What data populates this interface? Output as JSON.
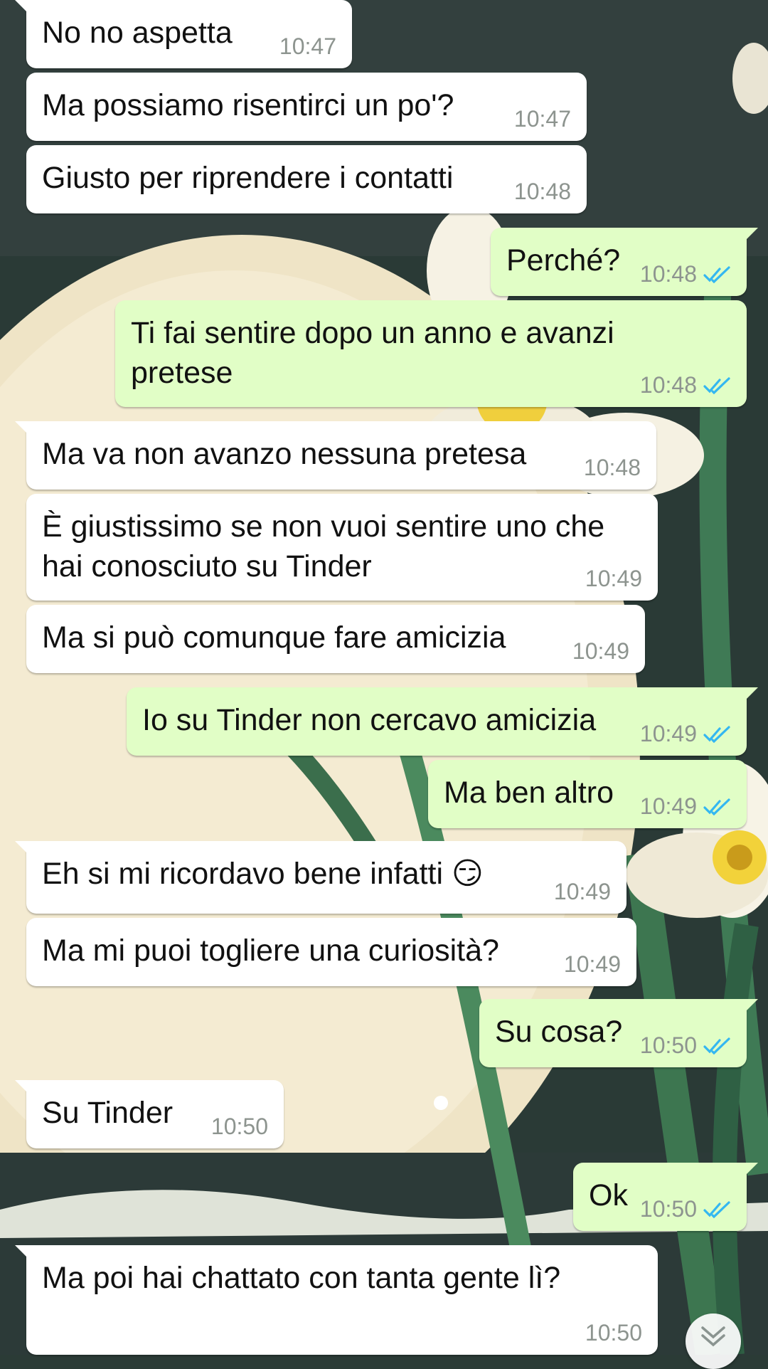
{
  "colors": {
    "incoming_bubble": "#ffffff",
    "outgoing_bubble": "#e1fec6",
    "timestamp": "#8d948f",
    "read_ticks": "#34b7f1"
  },
  "scroll_down_icon": "chevron-double-down-icon",
  "messages": [
    {
      "dir": "in",
      "text": "No no aspetta",
      "time": "10:47"
    },
    {
      "dir": "in",
      "text": "Ma possiamo risentirci un po'?",
      "time": "10:47"
    },
    {
      "dir": "in",
      "text": "Giusto per riprendere i contatti",
      "time": "10:48"
    },
    {
      "dir": "out",
      "text": "Perché?",
      "time": "10:48"
    },
    {
      "dir": "out",
      "text": "Ti fai sentire dopo un anno e avanzi\npretese",
      "time": "10:48"
    },
    {
      "dir": "in",
      "text": "Ma va non avanzo nessuna pretesa",
      "time": "10:48"
    },
    {
      "dir": "in",
      "text": "È giustissimo se non vuoi sentire uno che\nhai conosciuto su Tinder",
      "time": "10:49"
    },
    {
      "dir": "in",
      "text": "Ma si può comunque fare amicizia",
      "time": "10:49"
    },
    {
      "dir": "out",
      "text": "Io su Tinder non cercavo amicizia",
      "time": "10:49"
    },
    {
      "dir": "out",
      "text": "Ma ben altro",
      "time": "10:49"
    },
    {
      "dir": "in",
      "text": "Eh si mi ricordavo bene infatti 😏",
      "time": "10:49"
    },
    {
      "dir": "in",
      "text": "Ma mi puoi togliere una curiosità?",
      "time": "10:49"
    },
    {
      "dir": "out",
      "text": "Su cosa?",
      "time": "10:50"
    },
    {
      "dir": "in",
      "text": "Su Tinder",
      "time": "10:50"
    },
    {
      "dir": "out",
      "text": "Ok",
      "time": "10:50"
    },
    {
      "dir": "in",
      "text": "Ma poi hai chattato con tanta gente lì?",
      "time": "10:50"
    }
  ]
}
